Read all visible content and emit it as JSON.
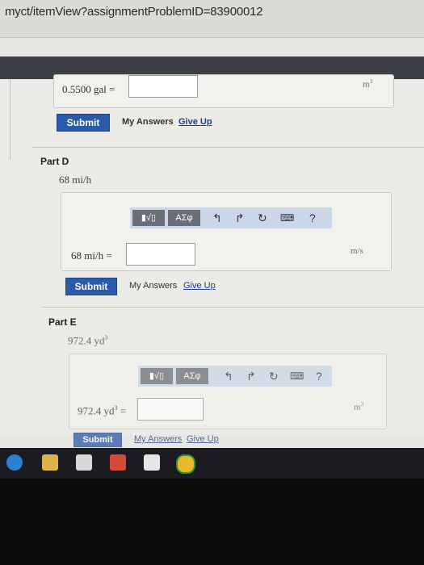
{
  "browser": {
    "url": "myct/itemView?assignmentProblemID=83900012"
  },
  "partC": {
    "eq_label": "0.5500 gal =",
    "unit": "m",
    "unit_sup": "3",
    "submit_label": "Submit",
    "my_answers_label": "My Answers",
    "give_up_label": "Give Up"
  },
  "partD": {
    "title": "Part D",
    "question": "68 mi/h",
    "toolbar": {
      "template_btn": "▮√▯",
      "greek_btn": "ΑΣφ",
      "help": "?"
    },
    "eq_label": "68 mi/h =",
    "unit": "m/s",
    "submit_label": "Submit",
    "my_answers_label": "My Answers",
    "give_up_label": "Give Up"
  },
  "partE": {
    "title": "Part E",
    "question": "972.4 yd",
    "question_sup": "3",
    "toolbar": {
      "template_btn": "▮√▯",
      "greek_btn": "ΑΣφ",
      "help": "?"
    },
    "eq_label": "972.4 yd",
    "eq_sup": "3",
    "eq_suffix": " =",
    "unit": "m",
    "unit_sup": "3",
    "submit_label": "Submit",
    "my_answers_label": "My Answers",
    "give_up_label": "Give Up"
  },
  "colors": {
    "submit_blue": "#2b5aa8",
    "toolbar_blue": "#c9d7e8",
    "link_blue": "#1c3f86"
  }
}
